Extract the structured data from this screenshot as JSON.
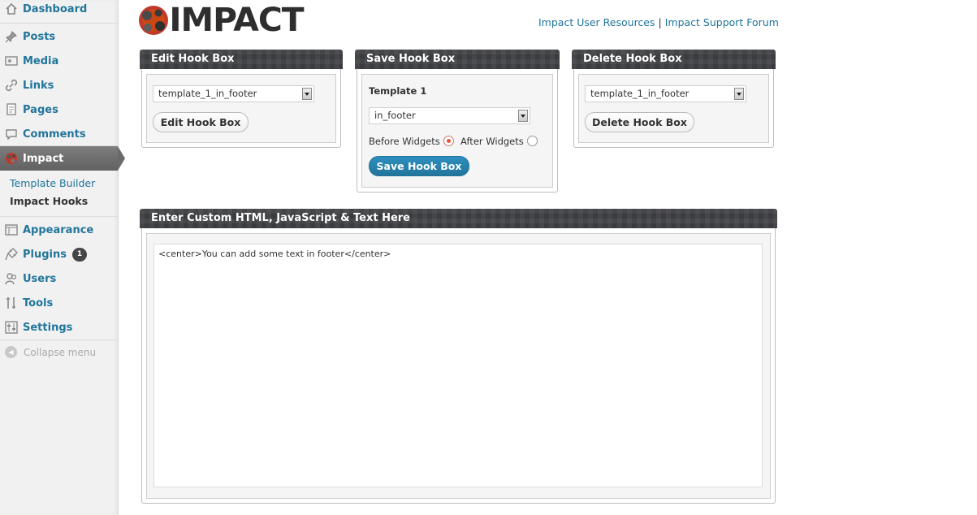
{
  "sidebar": {
    "items": [
      {
        "label": "Dashboard",
        "icon": "dashboard-icon"
      },
      {
        "label": "Posts",
        "icon": "pushpin-icon"
      },
      {
        "label": "Media",
        "icon": "media-icon"
      },
      {
        "label": "Links",
        "icon": "links-icon"
      },
      {
        "label": "Pages",
        "icon": "pages-icon"
      },
      {
        "label": "Comments",
        "icon": "comments-icon"
      },
      {
        "label": "Impact",
        "icon": "impact-icon"
      },
      {
        "label": "Appearance",
        "icon": "appearance-icon"
      },
      {
        "label": "Plugins",
        "icon": "plugins-icon",
        "badge": "1"
      },
      {
        "label": "Users",
        "icon": "users-icon"
      },
      {
        "label": "Tools",
        "icon": "tools-icon"
      },
      {
        "label": "Settings",
        "icon": "settings-icon"
      }
    ],
    "submenu": [
      "Template Builder",
      "Impact Hooks"
    ],
    "collapse_label": "Collapse menu"
  },
  "header": {
    "logo_text": "IMPACT",
    "link_resources": "Impact User Resources",
    "link_separator": "|",
    "link_forum": "Impact Support Forum"
  },
  "edit_box": {
    "title": "Edit Hook Box",
    "select_value": "template_1_in_footer",
    "button": "Edit Hook Box"
  },
  "save_box": {
    "title": "Save Hook Box",
    "template_label": "Template 1",
    "select_value": "in_footer",
    "before_label": "Before Widgets",
    "after_label": "After Widgets",
    "button": "Save Hook Box"
  },
  "delete_box": {
    "title": "Delete Hook Box",
    "select_value": "template_1_in_footer",
    "button": "Delete Hook Box"
  },
  "custom_box": {
    "title": "Enter Custom HTML, JavaScript & Text Here",
    "content": "<center>You can add some text in footer</center>"
  },
  "colors": {
    "link": "#21759b",
    "panel_header": "#3c3e42",
    "active_menu": "#6a6a6a",
    "radio_checked": "#e2553a"
  }
}
